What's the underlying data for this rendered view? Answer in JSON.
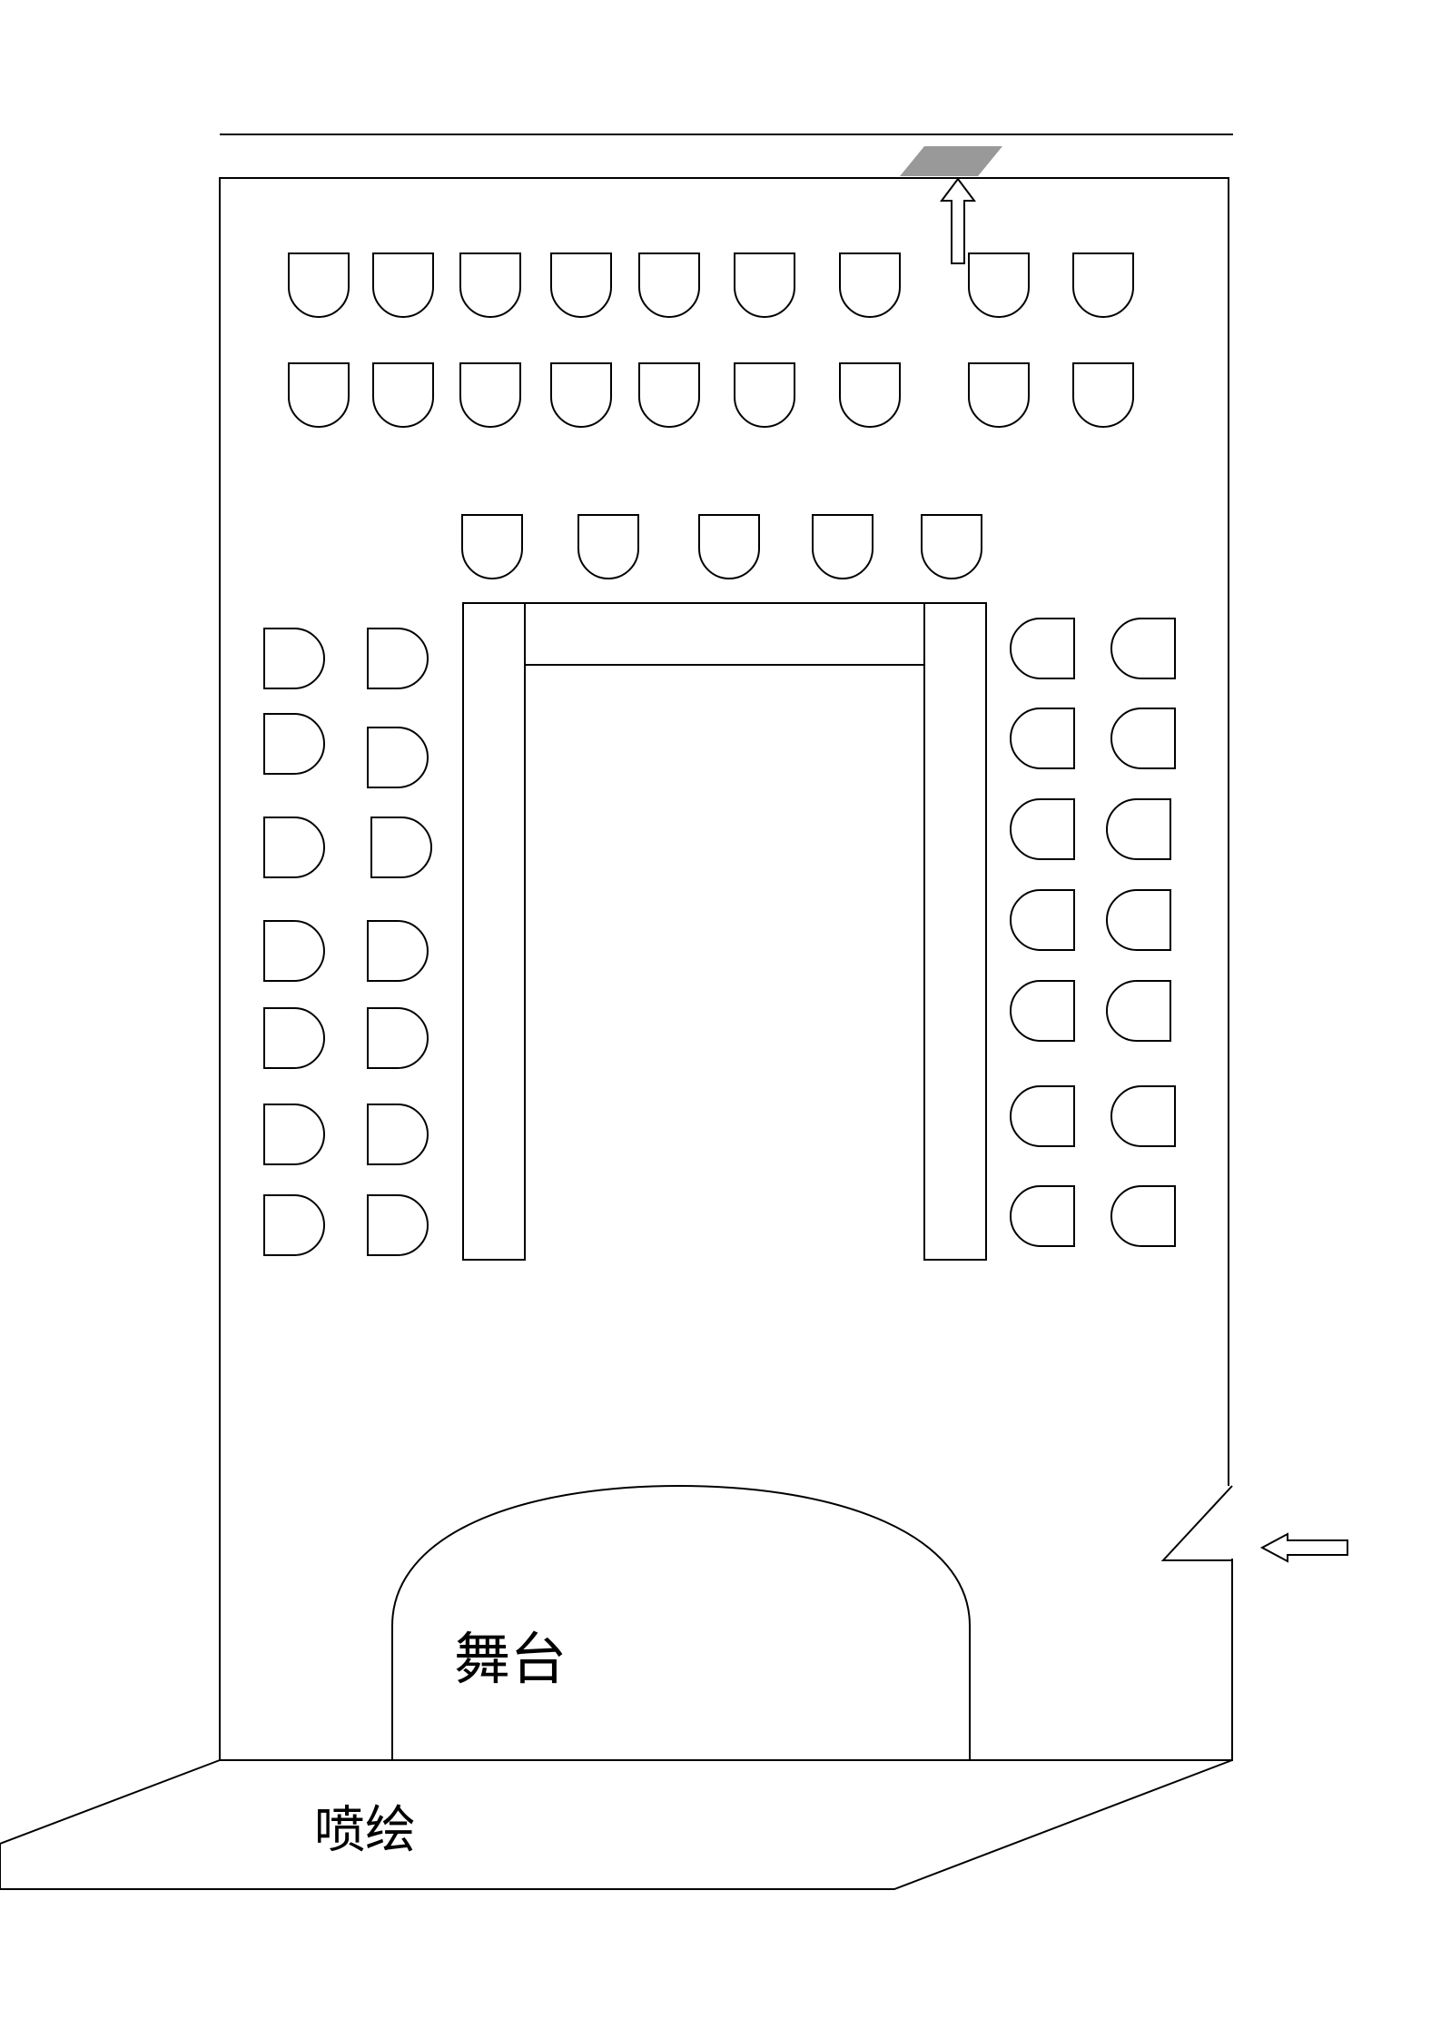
{
  "labels": {
    "stage": "舞台",
    "backdrop": "喷绘"
  },
  "colors": {
    "stroke": "#000000",
    "entrance_mark": "#999999",
    "background": "#ffffff"
  }
}
